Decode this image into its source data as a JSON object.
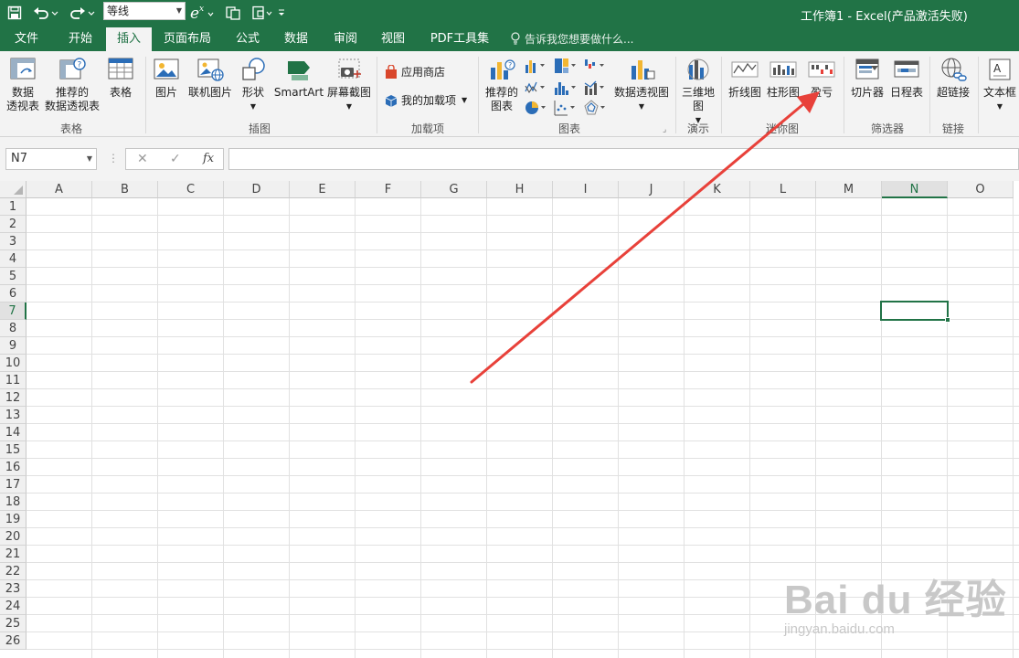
{
  "window": {
    "title": "工作簿1 - Excel(产品激活失败)",
    "font_name": "等线"
  },
  "tabs": [
    {
      "label": "文件"
    },
    {
      "label": "开始"
    },
    {
      "label": "插入",
      "active": true
    },
    {
      "label": "页面布局"
    },
    {
      "label": "公式"
    },
    {
      "label": "数据"
    },
    {
      "label": "审阅"
    },
    {
      "label": "视图"
    },
    {
      "label": "PDF工具集"
    }
  ],
  "tell_me": "告诉我您想要做什么...",
  "ribbon": {
    "groups": {
      "tables": "表格",
      "illustrations": "插图",
      "addins": "加载项",
      "charts": "图表",
      "tours": "演示",
      "sparklines": "迷你图",
      "filters": "筛选器",
      "links": "链接"
    },
    "buttons": {
      "pivot_table": "数据\n透视表",
      "recommended_pivot": "推荐的\n数据透视表",
      "table": "表格",
      "picture": "图片",
      "online_picture": "联机图片",
      "shapes": "形状",
      "smartart": "SmartArt",
      "screenshot": "屏幕截图",
      "store": "应用商店",
      "my_addins": "我的加载项",
      "recommended_charts": "推荐的\n图表",
      "pivot_chart": "数据透视图",
      "map_3d": "三维地\n图",
      "spark_line": "折线图",
      "spark_column": "柱形图",
      "spark_winloss": "盈亏",
      "slicer": "切片器",
      "timeline": "日程表",
      "hyperlink": "超链接",
      "textbox": "文本框"
    }
  },
  "formula_bar": {
    "name_box": "N7",
    "cancel": "✕",
    "enter": "✓",
    "fx": "fx",
    "value": ""
  },
  "sheet": {
    "columns": [
      "A",
      "B",
      "C",
      "D",
      "E",
      "F",
      "G",
      "H",
      "I",
      "J",
      "K",
      "L",
      "M",
      "N",
      "O"
    ],
    "rows": [
      "1",
      "2",
      "3",
      "4",
      "5",
      "6",
      "7",
      "8",
      "9",
      "10",
      "11",
      "12",
      "13",
      "14",
      "15",
      "16",
      "17",
      "18",
      "19",
      "20",
      "21",
      "22",
      "23",
      "24",
      "25",
      "26"
    ],
    "selected_column": "N",
    "selected_row": "7"
  },
  "watermark": {
    "main": "Bai du 经验",
    "sub": "jingyan.baidu.com"
  },
  "colors": {
    "accent": "#217346",
    "arrow": "#e8413a"
  }
}
